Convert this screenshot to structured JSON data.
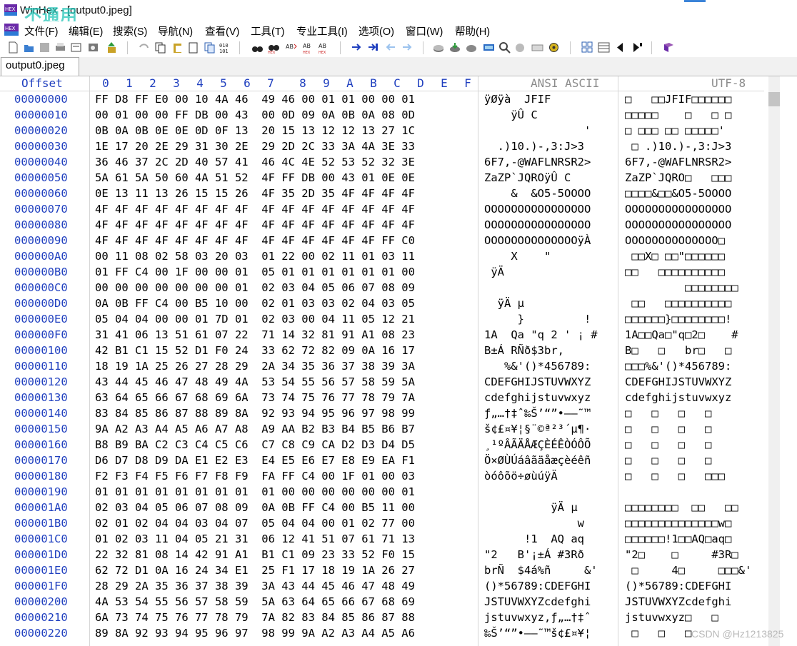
{
  "window": {
    "title": "WinHex - [output0.jpeg]",
    "overlay_text": "不通用",
    "app_icon": "winhex-icon"
  },
  "menu": [
    "文件(F)",
    "编辑(E)",
    "搜索(S)",
    "导航(N)",
    "查看(V)",
    "工具(T)",
    "专业工具(I)",
    "选项(O)",
    "窗口(W)",
    "帮助(H)"
  ],
  "toolbar": {
    "icons": [
      "new-file-icon",
      "open-icon",
      "save-icon",
      "print-icon",
      "properties-icon",
      "open-disk-icon",
      "export-icon",
      "undo-icon",
      "copy-icon",
      "paste-icon",
      "clipboard-icon",
      "write-icon",
      "insert-icon",
      "find-text-icon",
      "find-hex-icon",
      "replace-text-icon",
      "replace-hex-icon",
      "goto-offset-icon",
      "goto-position-icon",
      "back-icon",
      "forward-icon",
      "disk-icon",
      "ram-icon",
      "disk-tools-icon",
      "calculator-icon",
      "zoom-icon",
      "hash-icon",
      "settings-icon",
      "grid-icon",
      "table-icon",
      "prev-icon",
      "next-icon",
      "help-book-icon"
    ]
  },
  "tab": {
    "label": "output0.jpeg"
  },
  "header": {
    "offset": "Offset",
    "columns": [
      "0",
      "1",
      "2",
      "3",
      "4",
      "5",
      "6",
      "7",
      "8",
      "9",
      "A",
      "B",
      "C",
      "D",
      "E",
      "F"
    ],
    "ansi": "ANSI ASCII",
    "utf": "UTF-8"
  },
  "rows": [
    {
      "offset": "00000000",
      "hex": "FF D8 FF E0 00 10 4A 46  49 46 00 01 01 00 00 01",
      "ansi": "ÿØÿà  JFIF",
      "utf": "□   □□JFIF□□□□□□"
    },
    {
      "offset": "00000010",
      "hex": "00 01 00 00 FF DB 00 43  00 0D 09 0A 0B 0A 08 0D",
      "ansi": "    ÿÛ C",
      "utf": "□□□□□    □   □ □"
    },
    {
      "offset": "00000020",
      "hex": "0B 0A 0B 0E 0E 0D 0F 13  20 15 13 12 12 13 27 1C",
      "ansi": "               '",
      "utf": "□ □□□ □□ □□□□□'"
    },
    {
      "offset": "00000030",
      "hex": "1E 17 20 2E 29 31 30 2E  29 2D 2C 33 3A 4A 3E 33",
      "ansi": "  .)10.)-,3:J>3",
      "utf": " □ .)10.)-,3:J>3"
    },
    {
      "offset": "00000040",
      "hex": "36 46 37 2C 2D 40 57 41  46 4C 4E 52 53 52 32 3E",
      "ansi": "6F7,-@WAFLNRSR2>",
      "utf": "6F7,-@WAFLNRSR2>"
    },
    {
      "offset": "00000050",
      "hex": "5A 61 5A 50 60 4A 51 52  4F FF DB 00 43 01 0E 0E",
      "ansi": "ZaZP`JQROÿÛ C",
      "utf": "ZaZP`JQRO□   □□□"
    },
    {
      "offset": "00000060",
      "hex": "0E 13 11 13 26 15 15 26  4F 35 2D 35 4F 4F 4F 4F",
      "ansi": "    &  &O5-5OOOO",
      "utf": "□□□□&□□&O5-5OOOO"
    },
    {
      "offset": "00000070",
      "hex": "4F 4F 4F 4F 4F 4F 4F 4F  4F 4F 4F 4F 4F 4F 4F 4F",
      "ansi": "OOOOOOOOOOOOOOOO",
      "utf": "OOOOOOOOOOOOOOOO"
    },
    {
      "offset": "00000080",
      "hex": "4F 4F 4F 4F 4F 4F 4F 4F  4F 4F 4F 4F 4F 4F 4F 4F",
      "ansi": "OOOOOOOOOOOOOOOO",
      "utf": "OOOOOOOOOOOOOOOO"
    },
    {
      "offset": "00000090",
      "hex": "4F 4F 4F 4F 4F 4F 4F 4F  4F 4F 4F 4F 4F 4F FF C0",
      "ansi": "OOOOOOOOOOOOOOÿÀ",
      "utf": "OOOOOOOOOOOOOO□"
    },
    {
      "offset": "000000A0",
      "hex": "00 11 08 02 58 03 20 03  01 22 00 02 11 01 03 11",
      "ansi": "    X    \"",
      "utf": " □□X□ □□\"□□□□□□"
    },
    {
      "offset": "000000B0",
      "hex": "01 FF C4 00 1F 00 00 01  05 01 01 01 01 01 01 00",
      "ansi": " ÿÄ",
      "utf": "□□   □□□□□□□□□□"
    },
    {
      "offset": "000000C0",
      "hex": "00 00 00 00 00 00 00 01  02 03 04 05 06 07 08 09",
      "ansi": "",
      "utf": "         □□□□□□□□"
    },
    {
      "offset": "000000D0",
      "hex": "0A 0B FF C4 00 B5 10 00  02 01 03 03 02 04 03 05",
      "ansi": "  ÿÄ µ",
      "utf": " □□   □□□□□□□□□□"
    },
    {
      "offset": "000000E0",
      "hex": "05 04 04 00 00 01 7D 01  02 03 00 04 11 05 12 21",
      "ansi": "     }         !",
      "utf": "□□□□□□}□□□□□□□□!"
    },
    {
      "offset": "000000F0",
      "hex": "31 41 06 13 51 61 07 22  71 14 32 81 91 A1 08 23",
      "ansi": "1A  Qa \"q 2 ' ¡ #",
      "utf": "1A□□Qa□\"q□2□    #"
    },
    {
      "offset": "00000100",
      "hex": "42 B1 C1 15 52 D1 F0 24  33 62 72 82 09 0A 16 17",
      "ansi": "B±Á RÑð$3br,",
      "utf": "B□   □   br□   □"
    },
    {
      "offset": "00000110",
      "hex": "18 19 1A 25 26 27 28 29  2A 34 35 36 37 38 39 3A",
      "ansi": "   %&'()*456789:",
      "utf": "□□□%&'()*456789:"
    },
    {
      "offset": "00000120",
      "hex": "43 44 45 46 47 48 49 4A  53 54 55 56 57 58 59 5A",
      "ansi": "CDEFGHIJSTUVWXYZ",
      "utf": "CDEFGHIJSTUVWXYZ"
    },
    {
      "offset": "00000130",
      "hex": "63 64 65 66 67 68 69 6A  73 74 75 76 77 78 79 7A",
      "ansi": "cdefghijstuvwxyz",
      "utf": "cdefghijstuvwxyz"
    },
    {
      "offset": "00000140",
      "hex": "83 84 85 86 87 88 89 8A  92 93 94 95 96 97 98 99",
      "ansi": "ƒ„…†‡ˆ‰Š’“”•–—˜™",
      "utf": "□   □   □   □"
    },
    {
      "offset": "00000150",
      "hex": "9A A2 A3 A4 A5 A6 A7 A8  A9 AA B2 B3 B4 B5 B6 B7",
      "ansi": "š¢£¤¥¦§¨©ª²³´µ¶·",
      "utf": "□   □   □   □"
    },
    {
      "offset": "00000160",
      "hex": "B8 B9 BA C2 C3 C4 C5 C6  C7 C8 C9 CA D2 D3 D4 D5",
      "ansi": "¸¹ºÂÃÄÅÆÇÈÉÊÒÓÔÕ",
      "utf": "□   □   □   □"
    },
    {
      "offset": "00000170",
      "hex": "D6 D7 D8 D9 DA E1 E2 E3  E4 E5 E6 E7 E8 E9 EA F1",
      "ansi": "Ö×ØÙÚáâãäåæçèéêñ",
      "utf": "□   □   □   □"
    },
    {
      "offset": "00000180",
      "hex": "F2 F3 F4 F5 F6 F7 F8 F9  FA FF C4 00 1F 01 00 03",
      "ansi": "òóôõö÷øùúÿÄ",
      "utf": "□   □   □   □□□"
    },
    {
      "offset": "00000190",
      "hex": "01 01 01 01 01 01 01 01  01 00 00 00 00 00 00 01",
      "ansi": "",
      "utf": ""
    },
    {
      "offset": "000001A0",
      "hex": "02 03 04 05 06 07 08 09  0A 0B FF C4 00 B5 11 00",
      "ansi": "          ÿÄ µ",
      "utf": "□□□□□□□□  □□   □□"
    },
    {
      "offset": "000001B0",
      "hex": "02 01 02 04 04 03 04 07  05 04 04 00 01 02 77 00",
      "ansi": "              w",
      "utf": "□□□□□□□□□□□□□□w□"
    },
    {
      "offset": "000001C0",
      "hex": "01 02 03 11 04 05 21 31  06 12 41 51 07 61 71 13",
      "ansi": "      !1  AQ aq",
      "utf": "□□□□□□!1□□AQ□aq□"
    },
    {
      "offset": "000001D0",
      "hex": "22 32 81 08 14 42 91 A1  B1 C1 09 23 33 52 F0 15",
      "ansi": "\"2   B'¡±Á #3Rð",
      "utf": "\"2□    □     #3R□"
    },
    {
      "offset": "000001E0",
      "hex": "62 72 D1 0A 16 24 34 E1  25 F1 17 18 19 1A 26 27",
      "ansi": "brÑ  $4á%ñ     &'",
      "utf": " □     4□     □□□&'"
    },
    {
      "offset": "000001F0",
      "hex": "28 29 2A 35 36 37 38 39  3A 43 44 45 46 47 48 49",
      "ansi": "()*56789:CDEFGHI",
      "utf": "()*56789:CDEFGHI"
    },
    {
      "offset": "00000200",
      "hex": "4A 53 54 55 56 57 58 59  5A 63 64 65 66 67 68 69",
      "ansi": "JSTUVWXYZcdefghi",
      "utf": "JSTUVWXYZcdefghi"
    },
    {
      "offset": "00000210",
      "hex": "6A 73 74 75 76 77 78 79  7A 82 83 84 85 86 87 88",
      "ansi": "jstuvwxyz,ƒ„…†‡ˆ",
      "utf": "jstuvwxyz□   □"
    },
    {
      "offset": "00000220",
      "hex": "89 8A 92 93 94 95 96 97  98 99 9A A2 A3 A4 A5 A6",
      "ansi": "‰Š’“”•–—˜™š¢£¤¥¦",
      "utf": " □   □   □"
    }
  ],
  "watermark": "CSDN @Hz1213825",
  "colors": {
    "offset_blue": "#1f3fbf",
    "header_gray": "#8b8b8b",
    "overlay_teal": "#24c5b8"
  }
}
